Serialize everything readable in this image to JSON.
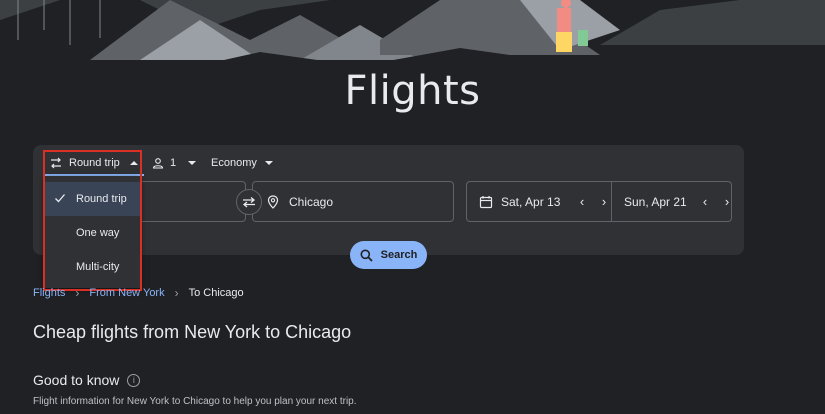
{
  "page": {
    "title": "Flights"
  },
  "search": {
    "trip_type": "Round trip",
    "passengers": "1",
    "cabin": "Economy",
    "origin": "",
    "destination": "Chicago",
    "depart_date": "Sat, Apr 13",
    "return_date": "Sun, Apr 21",
    "search_label": "Search"
  },
  "trip_menu": {
    "items": [
      {
        "label": "Round trip",
        "selected": true
      },
      {
        "label": "One way",
        "selected": false
      },
      {
        "label": "Multi-city",
        "selected": false
      }
    ]
  },
  "breadcrumb": {
    "items": [
      "Flights",
      "From New York",
      "To Chicago"
    ]
  },
  "content": {
    "heading": "Cheap flights from New York to Chicago",
    "good_to_know": "Good to know",
    "description": "Flight information for New York to Chicago to help you plan your next trip."
  },
  "colors": {
    "accent": "#8ab4f8",
    "highlight": "#d93025",
    "background": "#202124",
    "panel": "#303134"
  }
}
